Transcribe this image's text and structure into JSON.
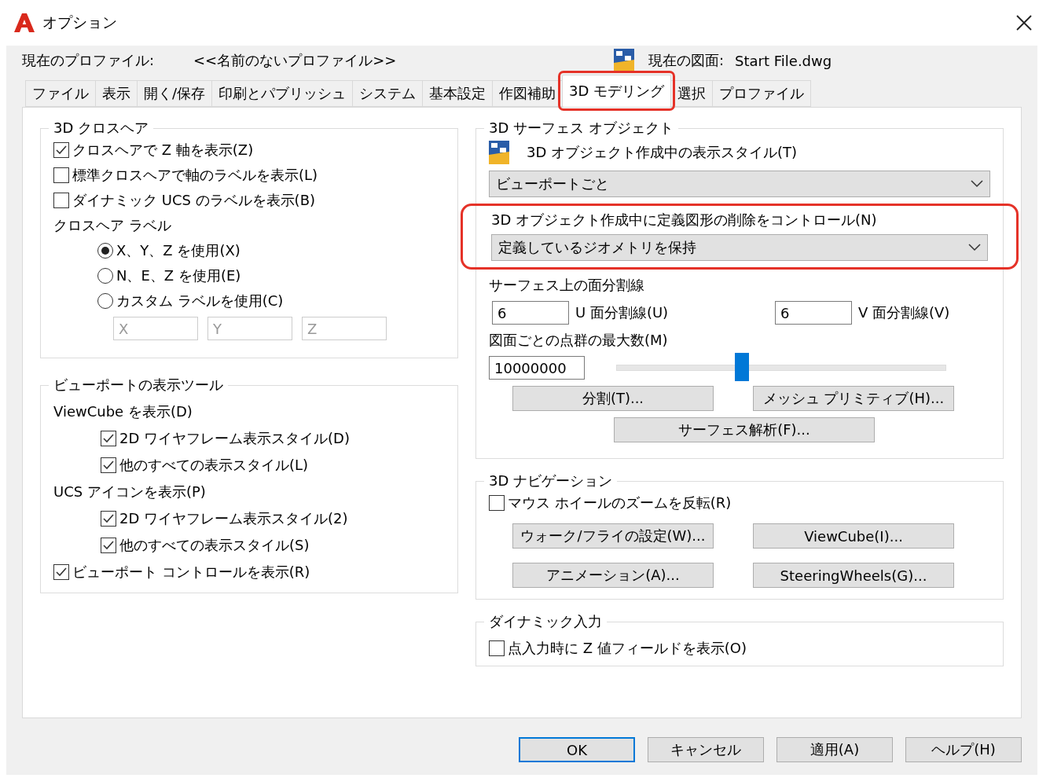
{
  "window": {
    "title": "オプション"
  },
  "profile": {
    "label": "現在のプロファイル:",
    "value": "<<名前のないプロファイル>>"
  },
  "drawing": {
    "label": "現在の図面:",
    "value": "Start File.dwg"
  },
  "tabs": [
    {
      "label": "ファイル",
      "selected": false,
      "highlighted": false
    },
    {
      "label": "表示",
      "selected": false,
      "highlighted": false
    },
    {
      "label": "開く/保存",
      "selected": false,
      "highlighted": false
    },
    {
      "label": "印刷とパブリッシュ",
      "selected": false,
      "highlighted": false
    },
    {
      "label": "システム",
      "selected": false,
      "highlighted": false
    },
    {
      "label": "基本設定",
      "selected": false,
      "highlighted": false
    },
    {
      "label": "作図補助",
      "selected": false,
      "highlighted": false
    },
    {
      "label": "3D モデリング",
      "selected": true,
      "highlighted": true
    },
    {
      "label": "選択",
      "selected": false,
      "highlighted": false
    },
    {
      "label": "プロファイル",
      "selected": false,
      "highlighted": false
    }
  ],
  "crosshair": {
    "title": "3D クロスヘア",
    "checkboxes": [
      {
        "label": "クロスヘアで Z 軸を表示(Z)",
        "checked": true
      },
      {
        "label": "標準クロスヘアで軸のラベルを表示(L)",
        "checked": false
      },
      {
        "label": "ダイナミック UCS のラベルを表示(B)",
        "checked": false
      }
    ],
    "label_title": "クロスヘア ラベル",
    "radios": [
      {
        "label": "X、Y、Z を使用(X)",
        "selected": true
      },
      {
        "label": "N、E、Z を使用(E)",
        "selected": false
      },
      {
        "label": "カスタム ラベルを使用(C)",
        "selected": false
      }
    ],
    "custom_fields": [
      {
        "value": "X",
        "disabled": true
      },
      {
        "value": "Y",
        "disabled": true
      },
      {
        "value": "Z",
        "disabled": true
      }
    ]
  },
  "viewport_tools": {
    "title": "ビューポートの表示ツール",
    "sections": [
      {
        "title": "ViewCube を表示(D)",
        "checkboxes": [
          {
            "label": "2D ワイヤフレーム表示スタイル(D)",
            "checked": true
          },
          {
            "label": "他のすべての表示スタイル(L)",
            "checked": true
          }
        ]
      },
      {
        "title": "UCS アイコンを表示(P)",
        "checkboxes": [
          {
            "label": "2D ワイヤフレーム表示スタイル(2)",
            "checked": true
          },
          {
            "label": "他のすべての表示スタイル(S)",
            "checked": true
          }
        ]
      }
    ],
    "bottom_checkbox": {
      "label": "ビューポート コントロールを表示(R)",
      "checked": true
    }
  },
  "surface": {
    "title": "3D サーフェス オブジェクト",
    "style_label": "3D オブジェクト作成中の表示スタイル(T)",
    "style_value": "ビューポートごと",
    "control_label": "3D オブジェクト作成中に定義図形の削除をコントロール(N)",
    "control_value": "定義しているジオメトリを保持",
    "control_highlighted": true,
    "tessellation_title": "サーフェス上の面分割線",
    "u_value": "6",
    "u_label": "U 面分割線(U)",
    "v_value": "6",
    "v_label": "V 面分割線(V)",
    "max_label": "図面ごとの点群の最大数(M)",
    "max_value": "10000000",
    "level": 0.38,
    "buttons": [
      "分割(T)...",
      "メッシュ プリミティブ(H)...",
      "サーフェス解析(F)..."
    ]
  },
  "navigation": {
    "title": "3D ナビゲーション",
    "checkbox": {
      "label": "マウス ホイールのズームを反転(R)",
      "checked": false
    },
    "buttons": [
      "ウォーク/フライの設定(W)...",
      "ViewCube(I)...",
      "アニメーション(A)...",
      "SteeringWheels(G)..."
    ]
  },
  "dynamic_input": {
    "title": "ダイナミック入力",
    "checkbox": {
      "label": "点入力時に Z 値フィールドを表示(O)",
      "checked": false
    }
  },
  "footer_buttons": [
    {
      "label": "OK",
      "default": true
    },
    {
      "label": "キャンセル",
      "default": false
    },
    {
      "label": "適用(A)",
      "default": false
    },
    {
      "label": "ヘルプ(H)",
      "default": false
    }
  ]
}
